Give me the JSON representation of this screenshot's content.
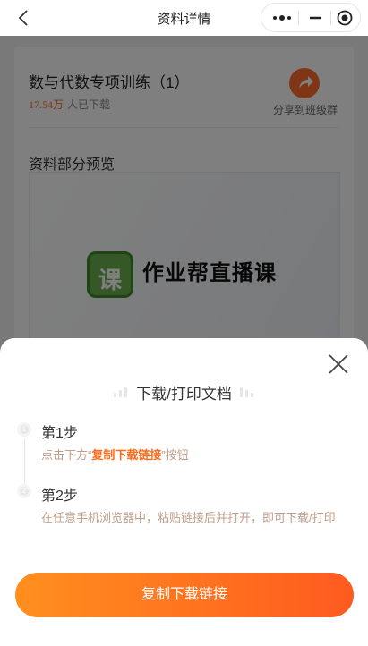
{
  "nav": {
    "title": "资料详情"
  },
  "document": {
    "title": "数与代数专项训练（1）",
    "download_count": "17.54万",
    "download_suffix": "人已下载",
    "share_label": "分享到班级群",
    "preview_title": "资料部分预览",
    "logo_char": "课",
    "logo_text": "作业帮直播课"
  },
  "sheet": {
    "title": "下载/打印文档",
    "steps": [
      {
        "number": "1",
        "title": "第1步",
        "desc_prefix": "点击下方“",
        "desc_highlight": "复制下载链接",
        "desc_suffix": "”按钮"
      },
      {
        "number": "2",
        "title": "第2步",
        "desc": "在任意手机浏览器中，粘贴链接后并打开，即可下载/打印"
      }
    ],
    "button_label": "复制下载链接"
  },
  "colors": {
    "accent": "#ff6a1a",
    "button_start": "#ff8f1f",
    "button_end": "#ff5a1f",
    "step_desc": "#c29f8a"
  },
  "icons": [
    "back-arrow-icon",
    "more-dots-icon",
    "minimize-icon",
    "target-icon",
    "share-arrow-icon",
    "close-icon"
  ]
}
